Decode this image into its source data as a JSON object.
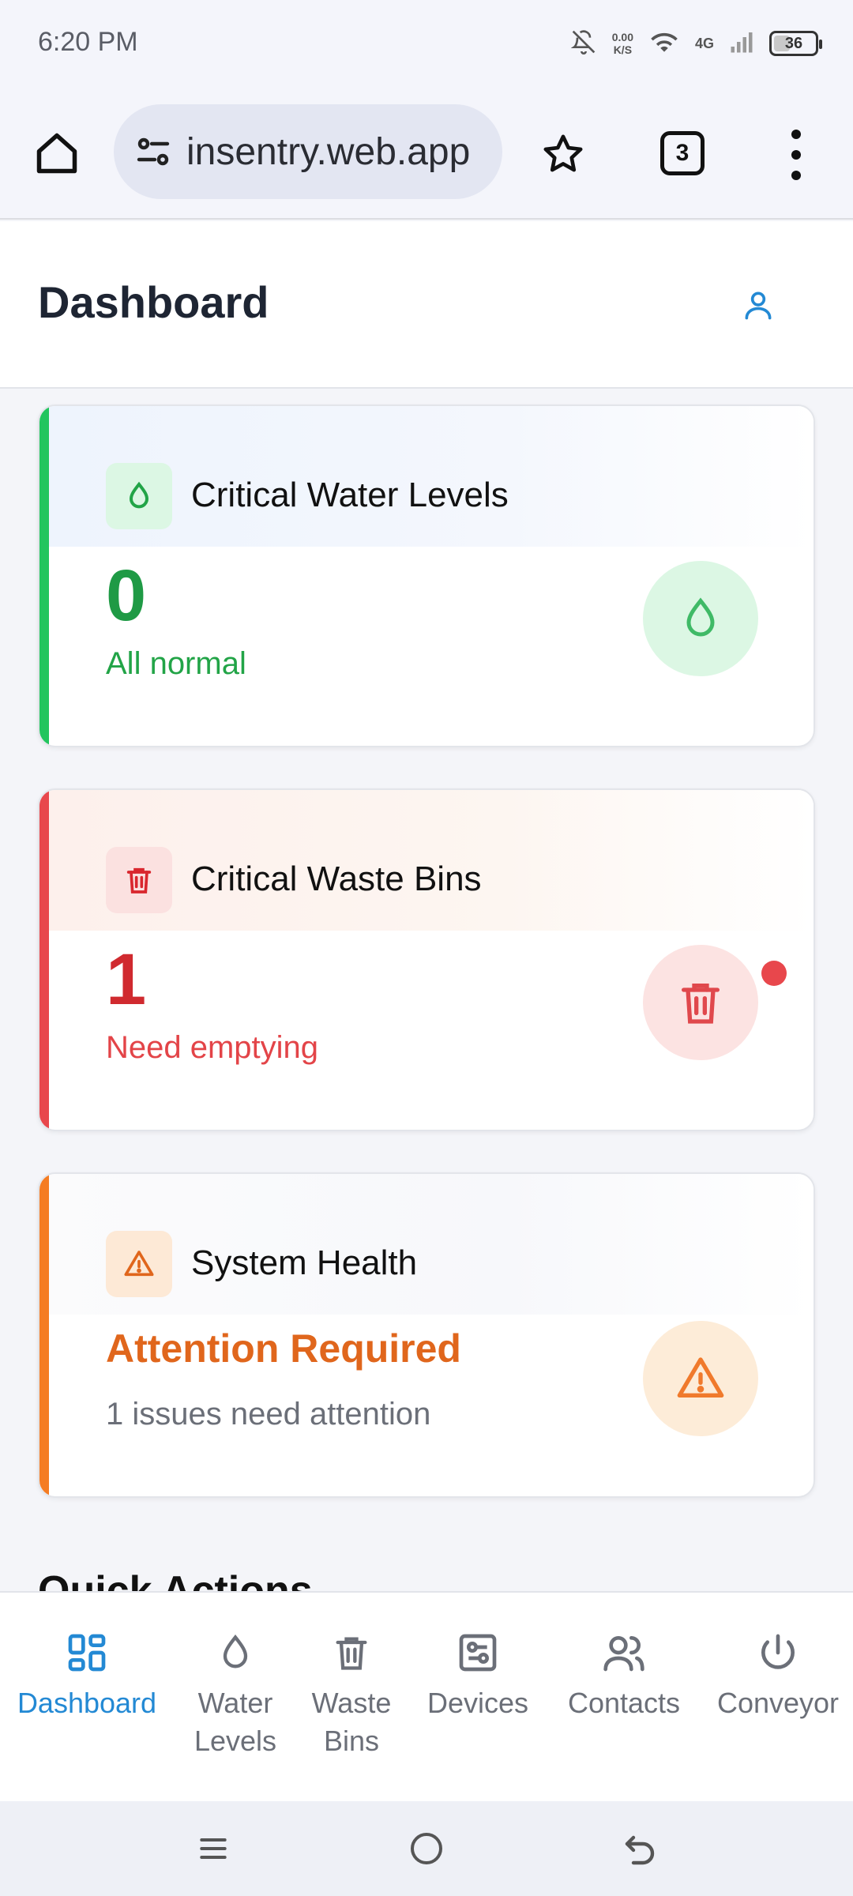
{
  "status_bar": {
    "time": "6:20 PM",
    "net_speed": "0.00\nK/S",
    "net_speed_value": "0.00",
    "net_speed_unit": "K/S",
    "network_type": "4G",
    "battery": "36"
  },
  "browser": {
    "url": "insentry.web.app",
    "tab_count": "3"
  },
  "header": {
    "title": "Dashboard"
  },
  "cards": [
    {
      "title": "Critical Water Levels",
      "value": "0",
      "subtitle": "All normal",
      "accent_color": "#22c55e",
      "icon": "droplet-icon"
    },
    {
      "title": "Critical Waste Bins",
      "value": "1",
      "subtitle": "Need emptying",
      "accent_color": "#e8474c",
      "icon": "trash-icon"
    },
    {
      "title": "System Health",
      "value": "Attention Required",
      "subtitle": "1 issues need attention",
      "accent_color": "#f57c22",
      "icon": "warning-icon"
    }
  ],
  "quick_actions": {
    "heading": "Quick Actions"
  },
  "bottom_nav": {
    "items": [
      {
        "label": "Dashboard",
        "icon": "grid-icon",
        "active": true
      },
      {
        "label": "Water\nLevels",
        "label_1": "Water",
        "label_2": "Levels",
        "icon": "droplet-icon"
      },
      {
        "label": "Waste\nBins",
        "label_1": "Waste",
        "label_2": "Bins",
        "icon": "trash-icon"
      },
      {
        "label": "Devices",
        "icon": "cpu-icon"
      },
      {
        "label": "Contacts",
        "icon": "users-icon"
      },
      {
        "label": "Conveyor",
        "icon": "power-icon"
      }
    ]
  },
  "colors": {
    "primary": "#2389d4",
    "success": "#22a447",
    "danger": "#d9272e",
    "warning": "#e0661c"
  }
}
